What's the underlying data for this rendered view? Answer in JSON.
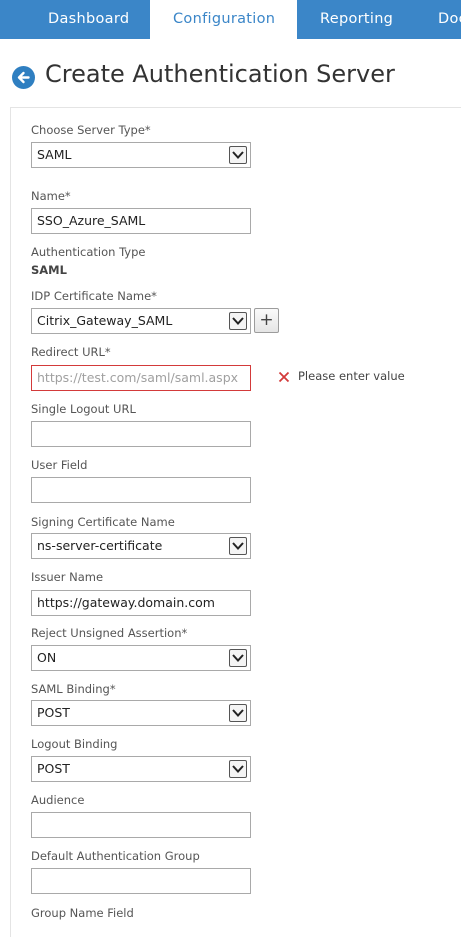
{
  "tabs": {
    "dashboard": "Dashboard",
    "configuration": "Configuration",
    "reporting": "Reporting",
    "documentation": "Doc"
  },
  "page_title": "Create Authentication Server",
  "form": {
    "server_type": {
      "label": "Choose Server Type*",
      "value": "SAML"
    },
    "name": {
      "label": "Name*",
      "value": "SSO_Azure_SAML"
    },
    "auth_type": {
      "label": "Authentication Type",
      "value": "SAML"
    },
    "idp_cert": {
      "label": "IDP Certificate Name*",
      "value": "Citrix_Gateway_SAML",
      "add_label": "+"
    },
    "redirect_url": {
      "label": "Redirect URL*",
      "placeholder": "https://test.com/saml/saml.aspx",
      "error": "Please enter value"
    },
    "single_logout_url": {
      "label": "Single Logout URL",
      "value": ""
    },
    "user_field": {
      "label": "User Field",
      "value": ""
    },
    "signing_cert": {
      "label": "Signing Certificate Name",
      "value": "ns-server-certificate"
    },
    "issuer_name": {
      "label": "Issuer Name",
      "value": "https://gateway.domain.com"
    },
    "reject_unsigned": {
      "label": "Reject Unsigned Assertion*",
      "value": "ON"
    },
    "saml_binding": {
      "label": "SAML Binding*",
      "value": "POST"
    },
    "logout_binding": {
      "label": "Logout Binding",
      "value": "POST"
    },
    "audience": {
      "label": "Audience",
      "value": ""
    },
    "default_auth_group": {
      "label": "Default Authentication Group",
      "value": ""
    },
    "group_name_field": {
      "label": "Group Name Field"
    }
  },
  "colors": {
    "accent": "#3b86c8",
    "error": "#d33a3a"
  }
}
